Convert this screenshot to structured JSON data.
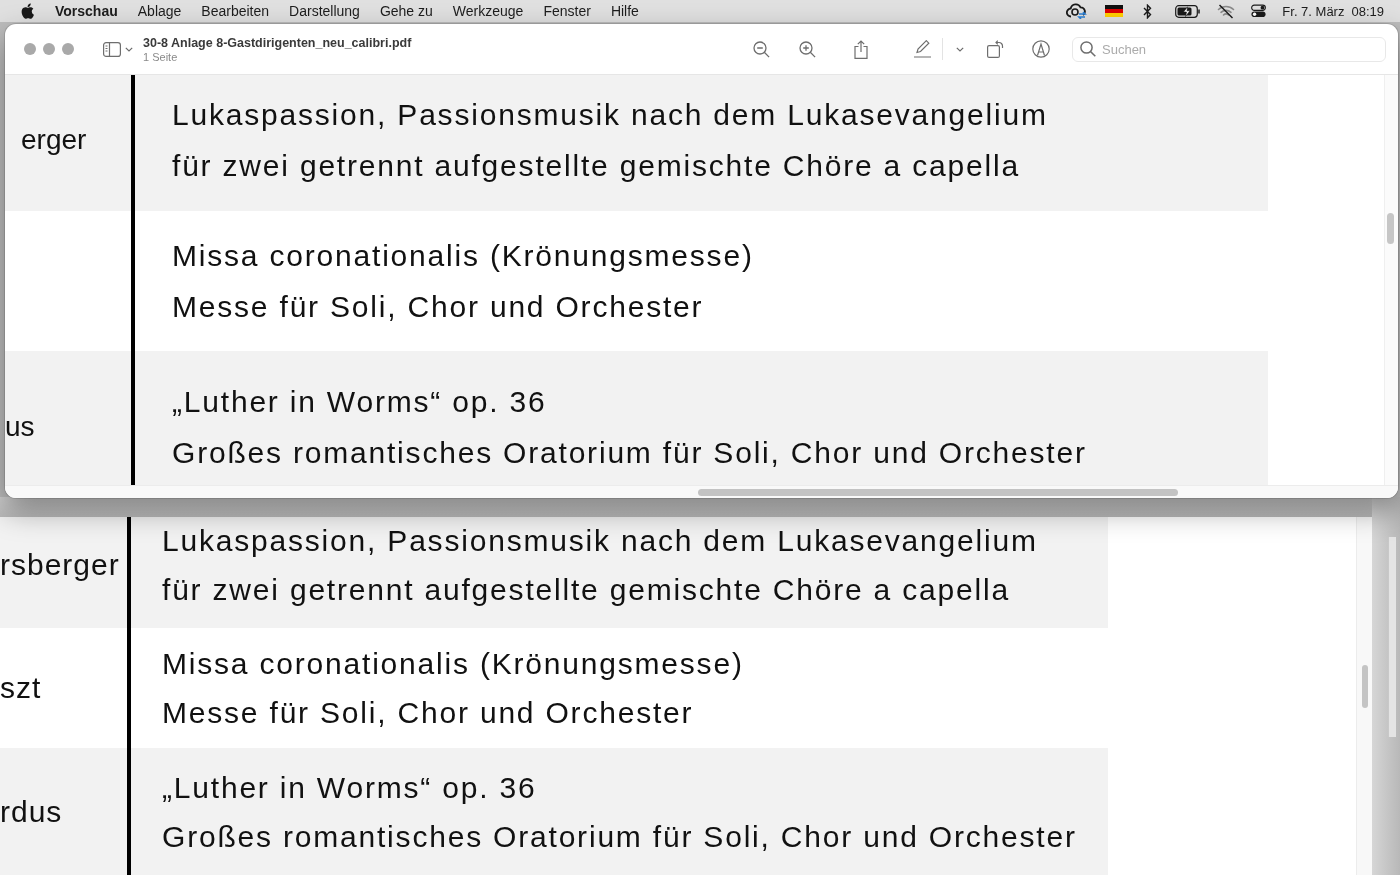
{
  "menu_bar": {
    "app_name": "Vorschau",
    "menus": [
      "Ablage",
      "Bearbeiten",
      "Darstellung",
      "Gehe zu",
      "Werkzeuge",
      "Fenster",
      "Hilfe"
    ],
    "date": "Fr. 7. März",
    "time": "08:19"
  },
  "front_window": {
    "title": "30-8 Anlage 8-Gastdirigenten_neu_calibri.pdf",
    "subtitle": "1 Seite",
    "search": {
      "placeholder": "Suchen"
    },
    "table": {
      "rows": [
        {
          "column_1": "erger",
          "column_2": [
            "Lukaspassion, Passionsmusik nach dem Lukasevangelium",
            "für zwei getrennt aufgestellte gemischte Chöre a capella"
          ],
          "shaded": true
        },
        {
          "column_2": [
            "Missa coronationalis (Krönungsmesse)",
            "Messe für Soli, Chor und Orchester"
          ],
          "shaded": false
        },
        {
          "column_1": "us",
          "column_2": [
            "„Luther in Worms“ op. 36",
            "Großes romantisches Oratorium für Soli, Chor und Orchester"
          ],
          "shaded": true
        }
      ]
    }
  },
  "back_window": {
    "table": {
      "rows": [
        {
          "column_1": "rsberger",
          "column_2": [
            "Lukaspassion, Passionsmusik nach dem Lukasevangelium",
            "für zwei getrennt aufgestellte gemischte Chöre a capella"
          ],
          "shaded": true
        },
        {
          "column_1": "szt",
          "column_2": [
            "Missa coronationalis (Krönungsmesse)",
            "Messe für Soli, Chor und Orchester"
          ],
          "shaded": false
        },
        {
          "column_1": "rdus",
          "column_2": [
            "„Luther in Worms“ op. 36",
            "Großes romantisches Oratorium für Soli, Chor und Orchester"
          ],
          "shaded": true
        }
      ]
    }
  }
}
